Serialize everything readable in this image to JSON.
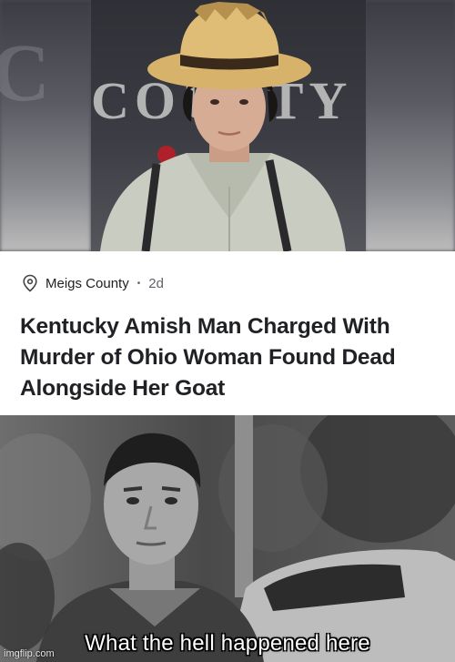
{
  "photo_background_text": "COUNTY",
  "article": {
    "location": "Meigs County",
    "separator": "•",
    "age": "2d",
    "headline": "Kentucky Amish Man Charged With Murder of Ohio Woman Found Dead Alongside Her Goat",
    "location_icon": "location-pin-icon"
  },
  "meme": {
    "caption": "What the hell happened here",
    "watermark": "imgflip.com"
  },
  "colors": {
    "headline_text": "#202124",
    "secondary_text": "#5f6368",
    "caption_text": "#ffffff"
  }
}
